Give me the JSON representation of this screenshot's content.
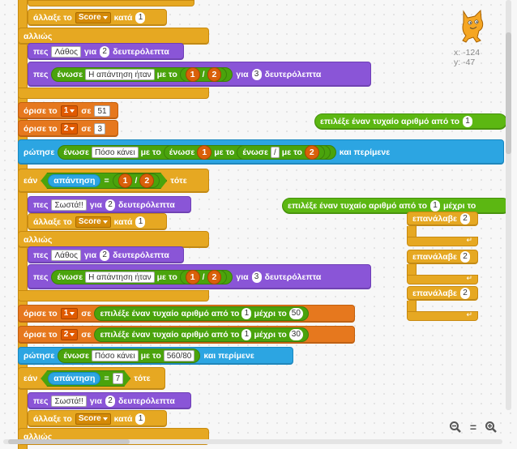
{
  "colors": {
    "control": "#e6a822",
    "looks": "#8a55d7",
    "data": "#e6781e",
    "operators": "#5cb712",
    "sensing": "#2ca5e2"
  },
  "sprite": {
    "icon": "cat-sprite-icon",
    "x_label": "x: -124",
    "y_label": "y: -47"
  },
  "kw": {
    "alaxe": "άλλαξε το",
    "kata": "κατά",
    "allios": "αλλιώς",
    "pes": "πες",
    "gia": "για",
    "deuterolepta": "δευτερόλεπτα",
    "enose": "ένωσε",
    "me_to": "με το",
    "orise": "όρισε το",
    "se": "σε",
    "rotise": "ρώτησε",
    "kai_perimene": "και περίμενε",
    "ean": "εάν",
    "tote": "τότε",
    "apantisi": "απάντηση",
    "epilexe": "επιλέξε έναν τυχαίο αριθμό από το",
    "mexri": "μέχρι το",
    "epanalave": "επανάλαβε",
    "to": "το",
    "eq": "=",
    "slash": "/"
  },
  "vals": {
    "score": "Score",
    "one": "1",
    "two": "2",
    "three": "3",
    "lathos": "Λάθος",
    "swsta": "Σωστά!!",
    "apantisi_itan": "Η απάντηση ήταν",
    "fifty_one": "51",
    "poso_kanei": "Πόσο κάνει",
    "slash_in": "/",
    "fifty": "50",
    "thirty": "30",
    "frac": "560/80",
    "seven": "7",
    "v1": "1",
    "v2": "2"
  },
  "zoom": {
    "out": "−",
    "reset": "=",
    "in": "+"
  }
}
